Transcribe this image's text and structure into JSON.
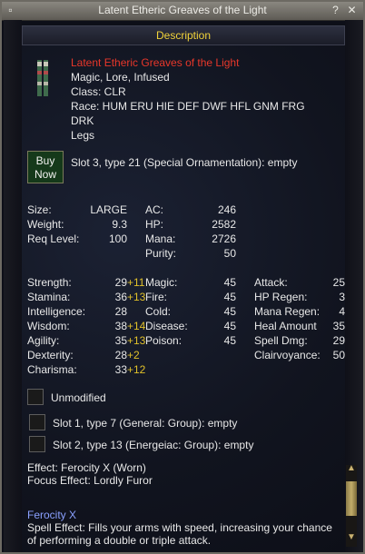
{
  "window": {
    "title": "Latent Etheric Greaves of the Light"
  },
  "header": {
    "label": "Description"
  },
  "item": {
    "name": "Latent Etheric Greaves of the Light",
    "flags": "Magic, Lore, Infused",
    "class": "Class: CLR",
    "race_line1": "Race: HUM ERU HIE DEF DWF HFL GNM FRG",
    "race_line2": "DRK",
    "slot": "Legs",
    "icon": "greaves-icon"
  },
  "buy": {
    "label_line1": "Buy",
    "label_line2": "Now"
  },
  "ornament_slot": "Slot 3, type 21 (Special Ornamentation): empty",
  "stats_basic": [
    {
      "label": "Size:",
      "value": "LARGE"
    },
    {
      "label": "Weight:",
      "value": "9.3"
    },
    {
      "label": "Req Level:",
      "value": "100"
    }
  ],
  "stats_def": [
    {
      "label": "AC:",
      "value": "246"
    },
    {
      "label": "HP:",
      "value": "2582"
    },
    {
      "label": "Mana:",
      "value": "2726"
    },
    {
      "label": "Purity:",
      "value": "50"
    }
  ],
  "stats_attr": [
    {
      "label": "Strength:",
      "value": "29",
      "bonus": "+11"
    },
    {
      "label": "Stamina:",
      "value": "36",
      "bonus": "+13"
    },
    {
      "label": "Intelligence:",
      "value": "28",
      "bonus": ""
    },
    {
      "label": "Wisdom:",
      "value": "38",
      "bonus": "+14"
    },
    {
      "label": "Agility:",
      "value": "35",
      "bonus": "+13"
    },
    {
      "label": "Dexterity:",
      "value": "28",
      "bonus": "+2"
    },
    {
      "label": "Charisma:",
      "value": "33",
      "bonus": "+12"
    }
  ],
  "stats_resist": [
    {
      "label": "Magic:",
      "value": "45"
    },
    {
      "label": "Fire:",
      "value": "45"
    },
    {
      "label": "Cold:",
      "value": "45"
    },
    {
      "label": "Disease:",
      "value": "45"
    },
    {
      "label": "Poison:",
      "value": "45"
    }
  ],
  "stats_mod": [
    {
      "label": "Attack:",
      "value": "25"
    },
    {
      "label": "HP Regen:",
      "value": "3"
    },
    {
      "label": "Mana Regen:",
      "value": "4"
    },
    {
      "label": "Heal Amount",
      "value": "35"
    },
    {
      "label": "Spell Dmg:",
      "value": "29"
    },
    {
      "label": "Clairvoyance:",
      "value": "50"
    }
  ],
  "unmodified_label": "Unmodified",
  "aug_slots": [
    "Slot 1, type 7 (General: Group): empty",
    "Slot 2, type 13 (Energeiac: Group): empty"
  ],
  "effects": {
    "effect": "Effect: Ferocity X (Worn)",
    "focus": "Focus Effect: Lordly Furor"
  },
  "spell": {
    "name": "Ferocity X",
    "desc_line1": "Spell Effect: Fills your arms with speed, increasing your chance",
    "desc_line2": "of performing a double or triple attack."
  },
  "colors": {
    "name": "#e8372a",
    "bonus": "#e0c02a",
    "header": "#f0d23a",
    "spell": "#8aa0ff"
  }
}
